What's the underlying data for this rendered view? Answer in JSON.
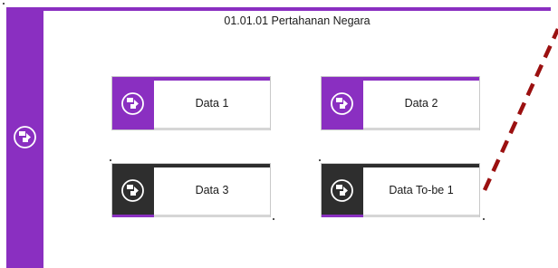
{
  "diagram": {
    "title": "01.01.01 Pertahanan Negara",
    "side_icon": "workflow-icon",
    "cards": [
      {
        "label": "Data 1",
        "icon": "workflow-icon",
        "color": "#8a2fc1"
      },
      {
        "label": "Data 2",
        "icon": "workflow-icon",
        "color": "#8a2fc1"
      },
      {
        "label": "Data 3",
        "icon": "workflow-icon",
        "color": "#2e2e2e"
      },
      {
        "label": "Data To-be 1",
        "icon": "workflow-icon",
        "color": "#2e2e2e"
      }
    ],
    "connector_color": "#9b1010"
  }
}
